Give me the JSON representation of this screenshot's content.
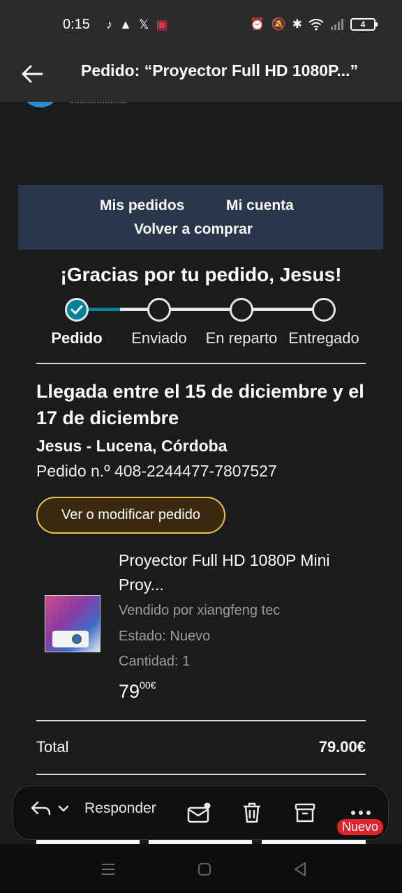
{
  "status_bar": {
    "time": "0:15",
    "app_icons": [
      "tiktok-icon",
      "gallery-icon",
      "x-icon",
      "shop-icon"
    ],
    "system_icons": [
      "alarm-icon",
      "mute-icon",
      "bluetooth-icon",
      "wifi-icon",
      "signal-icon"
    ],
    "battery": "4"
  },
  "header": {
    "title": "Pedido: “Proyector Full HD 1080P...”"
  },
  "email": {
    "nav_links": {
      "orders": "Mis pedidos",
      "account": "Mi cuenta",
      "buy_again": "Volver a comprar"
    },
    "thanks": "¡Gracias por tu pedido, Jesus!",
    "progress": {
      "steps": [
        "Pedido",
        "Enviado",
        "En reparto",
        "Entregado"
      ],
      "current_step": 1
    },
    "arrival": "Llegada entre el 15 de diciembre y el 17 de diciembre",
    "ship_to": "Jesus - Lucena, Córdoba",
    "order_number": "Pedido n.º 408-2244477-7807527",
    "view_button": "Ver o modificar pedido",
    "product": {
      "name": "Proyector Full HD 1080P Mini Proy...",
      "seller": "Vendido por xiangfeng tec",
      "condition": "Estado: Nuevo",
      "quantity": "Cantidad: 1",
      "price_whole": "79",
      "price_fraction": "00€"
    },
    "total_label": "Total",
    "total_value": "79.00€"
  },
  "actions": {
    "reply": "Responder",
    "new_badge": "Nuevo"
  },
  "colors": {
    "accent_teal": "#008296",
    "button_border": "#f0c14b",
    "nav_box": "#2a364a",
    "badge_red": "#e0242c"
  }
}
